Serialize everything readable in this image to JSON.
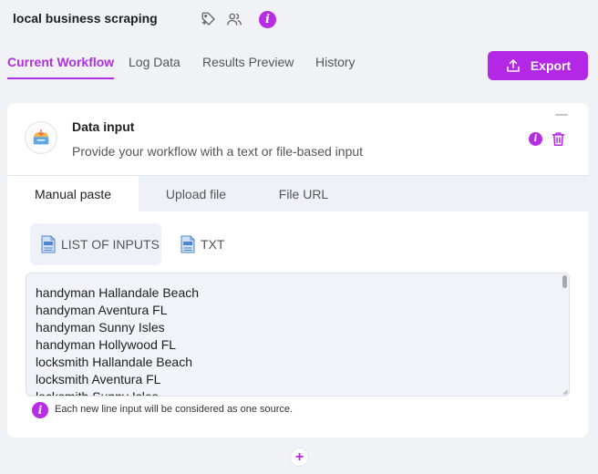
{
  "header": {
    "title": "local business scraping",
    "icons": [
      "tag-icon",
      "users-icon",
      "info-icon"
    ],
    "info_glyph": "i"
  },
  "tabs": [
    {
      "label": "Current Workflow",
      "active": true
    },
    {
      "label": "Log Data",
      "active": false
    },
    {
      "label": "Results Preview",
      "active": false
    },
    {
      "label": "History",
      "active": false
    }
  ],
  "export": {
    "label": "Export"
  },
  "step": {
    "title": "Data input",
    "description": "Provide your workflow with a text or file-based input",
    "info_glyph": "i"
  },
  "subtabs": [
    {
      "label": "Manual paste",
      "active": true
    },
    {
      "label": "Upload file",
      "active": false
    },
    {
      "label": "File URL",
      "active": false
    }
  ],
  "formats": [
    {
      "label": "LIST OF INPUTS",
      "active": true,
      "icon": "list-doc-icon"
    },
    {
      "label": "TXT",
      "active": false,
      "icon": "txt-doc-icon"
    }
  ],
  "input_lines": [
    "handyman Hallandale Beach",
    "handyman Aventura FL",
    "handyman Sunny Isles",
    "handyman Hollywood FL",
    "locksmith Hallandale Beach",
    "locksmith Aventura FL",
    "locksmith Sunny Isles"
  ],
  "hint": {
    "text": "Each new line input will be considered as one source.",
    "glyph": "i"
  },
  "add_step": {
    "glyph": "+"
  },
  "colors": {
    "accent": "#b427e6",
    "background": "#f1f2f6",
    "panel": "#eef1f8"
  }
}
